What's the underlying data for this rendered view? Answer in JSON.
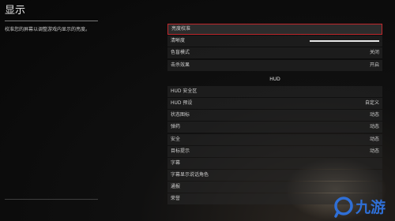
{
  "page": {
    "title": "显示",
    "description": "校准您的屏幕以调整游戏内显示的亮度。"
  },
  "settings": [
    {
      "label": "亮度校准",
      "value": "",
      "selected": true
    },
    {
      "label": "清晰度",
      "value": "",
      "slider": 1.0
    },
    {
      "label": "色盲模式",
      "value": "关闭"
    },
    {
      "label": "击杀效果",
      "value": "开启"
    }
  ],
  "hud_section": {
    "header": "HUD",
    "items": [
      {
        "label": "HUD 安全区",
        "value": ""
      },
      {
        "label": "HUD 预设",
        "value": "自定义"
      },
      {
        "label": "状态图标",
        "value": "动态"
      },
      {
        "label": "弹药",
        "value": "动态"
      },
      {
        "label": "安全",
        "value": "动态"
      },
      {
        "label": "目标提示",
        "value": "动态"
      },
      {
        "label": "字幕",
        "value": ""
      },
      {
        "label": "字幕显示说话角色",
        "value": ""
      },
      {
        "label": "通报",
        "value": ""
      },
      {
        "label": "荣誉",
        "value": ""
      }
    ]
  },
  "watermark": {
    "brand": "九游",
    "accent": "#2f6fd6"
  },
  "colors": {
    "selected_border": "#c0282d"
  }
}
